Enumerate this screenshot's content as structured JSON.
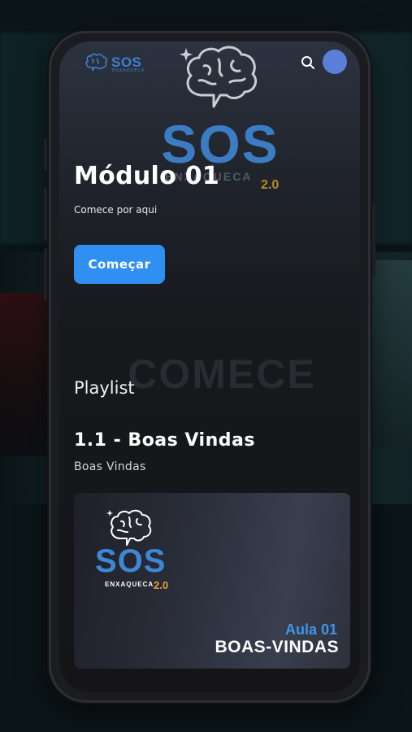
{
  "header": {
    "logo_text": "SOS",
    "logo_sub": "ENXAQUECA",
    "search_icon": "search-icon",
    "avatar_color": "#5b7fd6"
  },
  "hero": {
    "logo_text": "SOS",
    "logo_sub": "ENXAQUECA",
    "logo_version": "2.0",
    "title": "Módulo 01",
    "subtitle": "Comece por aqui",
    "button_label": "Começar",
    "watermark": "COMECE"
  },
  "playlist": {
    "label": "Playlist",
    "items": [
      {
        "title": "1.1 - Boas Vindas",
        "subtitle": "Boas Vindas",
        "thumbnail": {
          "logo_text": "SOS",
          "logo_sub": "ENXAQUECA",
          "logo_version": "2.0",
          "caption_top": "Aula 01",
          "caption_main": "BOAS-VINDAS"
        }
      }
    ]
  },
  "colors": {
    "accent": "#2f8ff2",
    "brand_blue": "#3f86d4",
    "brand_gold": "#e3a52a",
    "background": "#151518"
  }
}
